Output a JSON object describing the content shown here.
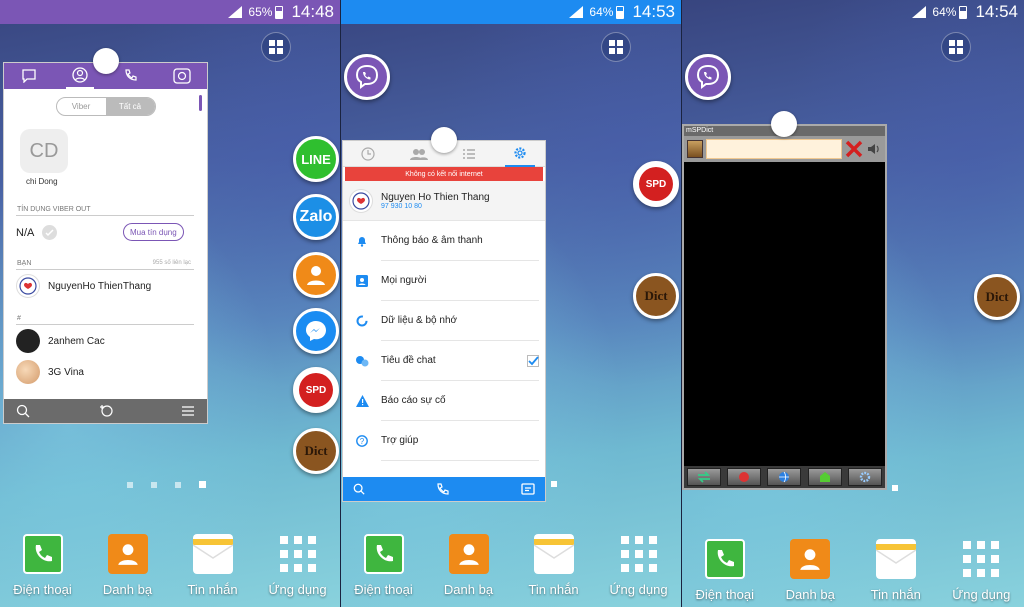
{
  "panels": [
    {
      "status": {
        "battery": "65%",
        "time": "14:48"
      }
    },
    {
      "status": {
        "battery": "64%",
        "time": "14:53"
      }
    },
    {
      "status": {
        "battery": "64%",
        "time": "14:54"
      }
    }
  ],
  "dock": {
    "phone": "Điện thoại",
    "contacts": "Danh bạ",
    "messages": "Tin nhắn",
    "apps": "Ứng dụng"
  },
  "floating_bubbles": {
    "line": "LINE",
    "zalo": "Zalo",
    "spd": "SPD",
    "dict": "Dict"
  },
  "viber": {
    "segment": {
      "left": "Viber",
      "right": "Tất cả"
    },
    "avatar_initials": "CD",
    "user_name": "chi Dong",
    "credit_section": "TÍN DỤNG VIBER OUT",
    "credit_value": "N/A",
    "buy_button": "Mua tín dụng",
    "friends_section": "BẠN",
    "contacts_count": "955 số liên lạc",
    "friend_name": "NguyenHo ThienThang",
    "hash_section": "#",
    "contacts": [
      "2anhem Cac",
      "3G Vina"
    ]
  },
  "settings": {
    "offline_banner": "Không có kết nối internet",
    "profile_name": "Nguyen Ho Thien Thang",
    "profile_phone": "97 930 10 80",
    "items": [
      {
        "label": "Thông báo & âm thanh"
      },
      {
        "label": "Mọi người"
      },
      {
        "label": "Dữ liệu & bộ nhớ"
      },
      {
        "label": "Tiêu đề chat"
      },
      {
        "label": "Báo cáo sự cố"
      },
      {
        "label": "Trợ giúp"
      }
    ]
  },
  "mspdict": {
    "title": "mSPDict"
  },
  "colors": {
    "viber_purple": "#7b56b5",
    "messenger_blue": "#1d8bf1",
    "alert_red": "#e8433c"
  }
}
